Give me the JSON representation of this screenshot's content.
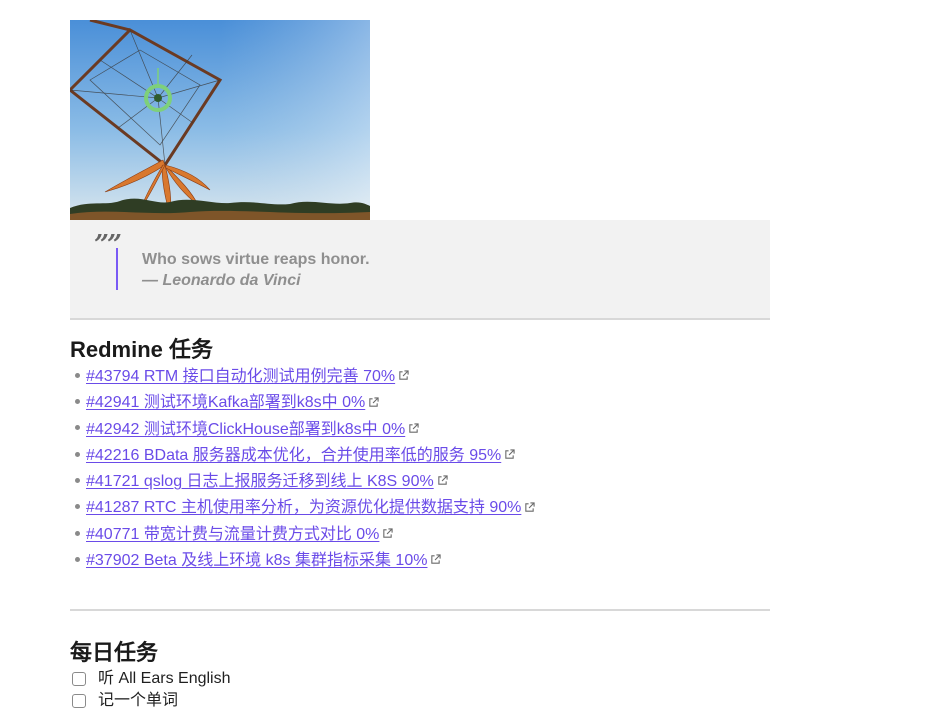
{
  "banner": {
    "icon": "dreamcatcher-photo"
  },
  "quote": {
    "icon": "quote-icon",
    "text": "Who sows virtue reaps honor.",
    "author": "— Leonardo da Vinci",
    "accent_color": "#7a5af5"
  },
  "redmine": {
    "title": "Redmine 任务",
    "link_color": "#6a4be8",
    "tasks": [
      {
        "label": "#43794 RTM 接口自动化测试用例完善 70%"
      },
      {
        "label": "#42941 测试环境Kafka部署到k8s中 0%"
      },
      {
        "label": "#42942 测试环境ClickHouse部署到k8s中 0%"
      },
      {
        "label": "#42216 BData 服务器成本优化，合并使用率低的服务 95%"
      },
      {
        "label": "#41721 qslog 日志上报服务迁移到线上 K8S 90%"
      },
      {
        "label": "#41287 RTC 主机使用率分析，为资源优化提供数据支持 90%"
      },
      {
        "label": "#40771 带宽计费与流量计费方式对比 0%"
      },
      {
        "label": "#37902 Beta 及线上环境 k8s 集群指标采集 10%"
      }
    ]
  },
  "daily": {
    "title": "每日任务",
    "items": [
      {
        "label": "听 All Ears English",
        "checked": false
      },
      {
        "label": "记一个单词",
        "checked": false
      }
    ]
  }
}
